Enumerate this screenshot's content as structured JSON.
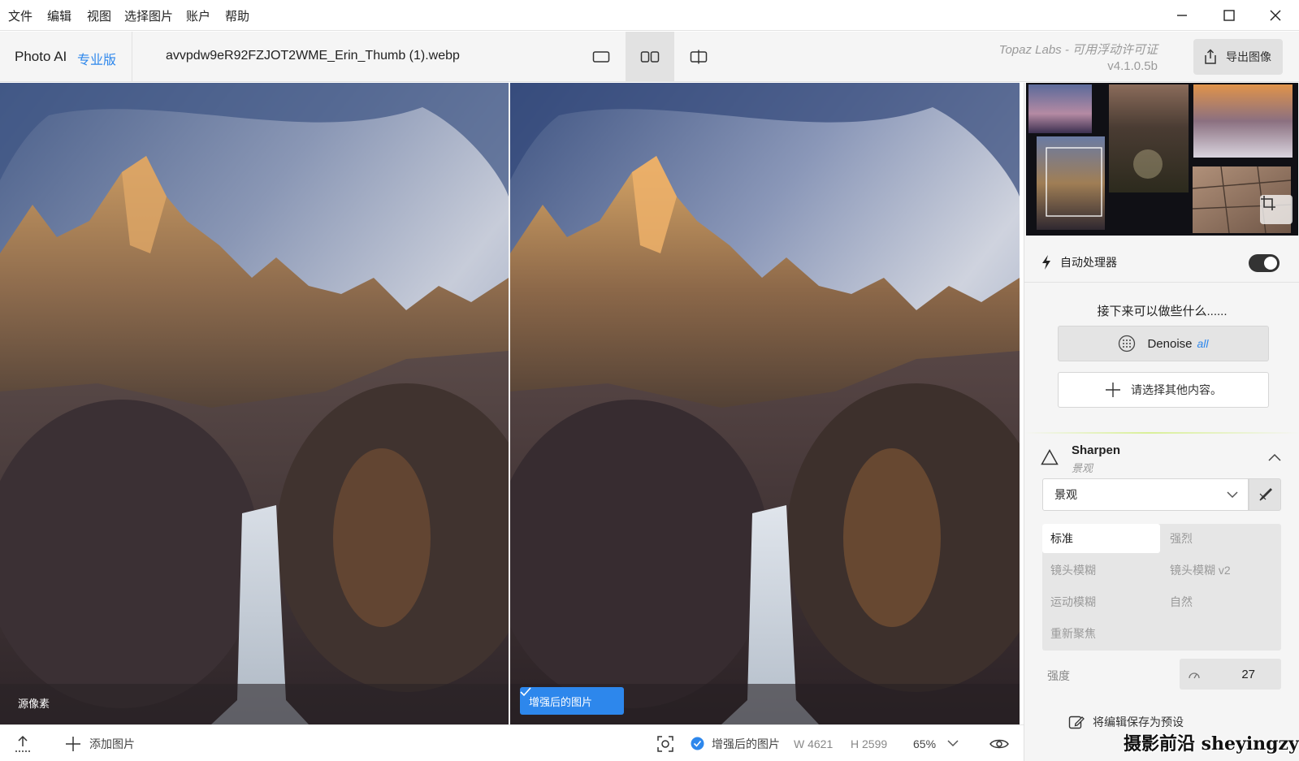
{
  "menu": [
    "文件",
    "编辑",
    "视图",
    "选择图片",
    "账户",
    "帮助"
  ],
  "toolbar": {
    "app_name": "Photo AI",
    "edition": "专业版",
    "filename": "avvpdw9eR92FZJOT2WME_Erin_Thumb (1).webp",
    "license": "Topaz Labs - 可用浮动许可证",
    "version": "v4.1.0.5b",
    "export_label": "导出图像"
  },
  "preview": {
    "source_label": "源像素",
    "enhanced_badge": "增强后的图片"
  },
  "bottombar": {
    "add_image": "添加图片",
    "enhanced_label": "增强后的图片",
    "width": "W 4621",
    "height": "H 2599",
    "zoom": "65%"
  },
  "sidepanel": {
    "autopilot_label": "自动处理器",
    "autopilot_on": true,
    "next_title": "接下来可以做些什么......",
    "denoise_label": "Denoise",
    "denoise_tag": "all",
    "other_label": "请选择其他内容。",
    "sharpen": {
      "title": "Sharpen",
      "subtitle": "景观",
      "model": "景观",
      "modes": [
        "标准",
        "强烈",
        "镜头模糊",
        "镜头模糊 v2",
        "运动模糊",
        "自然",
        "重新聚焦"
      ],
      "selected_mode": "标准",
      "strength_label": "强度",
      "strength_value": "27",
      "apply_all": "将编辑保存为预设"
    }
  },
  "watermark": "摄影前沿 sheyingzyz.com",
  "colors": {
    "accent": "#2d87ec",
    "panel_bg": "#f5f5f5",
    "toolbar_bg": "#f5f5f5"
  }
}
